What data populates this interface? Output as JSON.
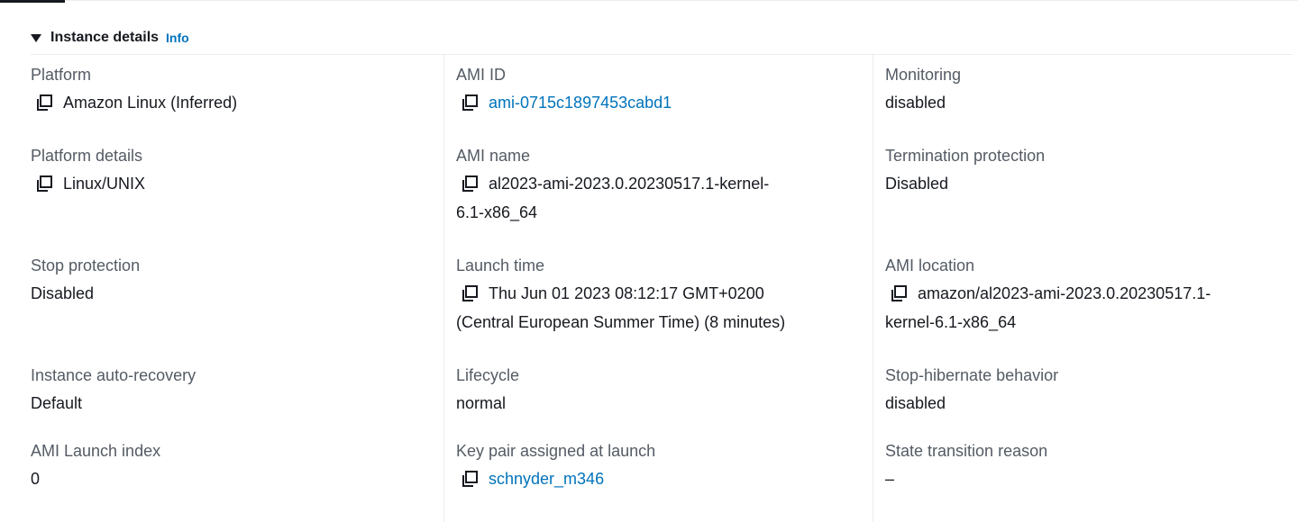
{
  "section": {
    "title": "Instance details",
    "info_label": "Info"
  },
  "columns": [
    {
      "fields": [
        {
          "label": "Platform",
          "value": "Amazon Linux (Inferred)",
          "copyable": true
        },
        {
          "label": "Platform details",
          "value": "Linux/UNIX",
          "copyable": true
        },
        {
          "label": "Stop protection",
          "value": "Disabled",
          "copyable": false
        },
        {
          "label": "Instance auto-recovery",
          "value": "Default",
          "copyable": false
        },
        {
          "label": "AMI Launch index",
          "value": "0",
          "copyable": false
        }
      ]
    },
    {
      "fields": [
        {
          "label": "AMI ID",
          "value": "ami-0715c1897453cabd1",
          "copyable": true,
          "link": true
        },
        {
          "label": "AMI name",
          "value_line1": "al2023-ami-2023.0.20230517.1-kernel-",
          "value_line2": "6.1-x86_64",
          "copyable": true
        },
        {
          "label": "Launch time",
          "value_line1": "Thu Jun 01 2023 08:12:17 GMT+0200",
          "value_line2": "(Central European Summer Time) (8 minutes)",
          "copyable": true
        },
        {
          "label": "Lifecycle",
          "value": "normal",
          "copyable": false
        },
        {
          "label": "Key pair assigned at launch",
          "value": "schnyder_m346",
          "copyable": true,
          "link": true
        }
      ]
    },
    {
      "fields": [
        {
          "label": "Monitoring",
          "value": "disabled",
          "copyable": false
        },
        {
          "label": "Termination protection",
          "value": "Disabled",
          "copyable": false
        },
        {
          "label": "AMI location",
          "value_line1": "amazon/al2023-ami-2023.0.20230517.1-",
          "value_line2": "kernel-6.1-x86_64",
          "copyable": true
        },
        {
          "label": "Stop-hibernate behavior",
          "value": "disabled",
          "copyable": false
        },
        {
          "label": "State transition reason",
          "value": "–",
          "copyable": false
        }
      ]
    }
  ],
  "icons": {
    "copy": "copy-icon",
    "caret": "caret-down-icon"
  },
  "colors": {
    "label": "#545b64",
    "value": "#16191f",
    "link": "#0073bb",
    "divider": "#eaeded"
  }
}
